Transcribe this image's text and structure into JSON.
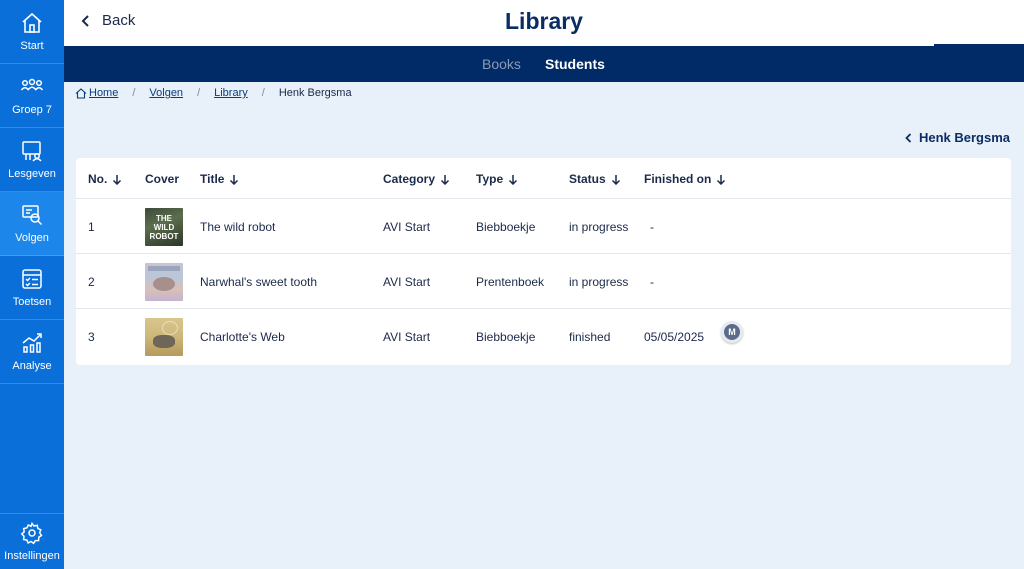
{
  "sidebar": {
    "items": [
      {
        "label": "Start",
        "icon": "home-icon"
      },
      {
        "label": "Groep 7",
        "icon": "group-icon"
      },
      {
        "label": "Lesgeven",
        "icon": "teach-icon"
      },
      {
        "label": "Volgen",
        "icon": "monitor-search-icon",
        "active": true
      },
      {
        "label": "Toetsen",
        "icon": "checklist-icon"
      },
      {
        "label": "Analyse",
        "icon": "analytics-icon"
      }
    ],
    "settings_label": "Instellingen"
  },
  "header": {
    "back_label": "Back",
    "title": "Library"
  },
  "tabs": [
    {
      "label": "Books",
      "active": false
    },
    {
      "label": "Students",
      "active": true
    }
  ],
  "breadcrumb": {
    "items": [
      "Home",
      "Volgen",
      "Library"
    ],
    "current": "Henk Bergsma"
  },
  "student_nav": {
    "name": "Henk Bergsma"
  },
  "table": {
    "columns": [
      "No.",
      "Cover",
      "Title",
      "Category",
      "Type",
      "Status",
      "Finished on"
    ],
    "rows": [
      {
        "no": "1",
        "title": "The wild robot",
        "cover_text": [
          "THE",
          "WILD",
          "ROBOT"
        ],
        "category": "AVI Start",
        "type": "Biebboekje",
        "status": "in progress",
        "finished_on": "-"
      },
      {
        "no": "2",
        "title": "Narwhal's sweet tooth",
        "category": "AVI Start",
        "type": "Prentenboek",
        "status": "in progress",
        "finished_on": "-"
      },
      {
        "no": "3",
        "title": "Charlotte's Web",
        "category": "AVI Start",
        "type": "Biebboekje",
        "status": "finished",
        "finished_on": "05/05/2025",
        "badge": "M"
      }
    ]
  },
  "colors": {
    "sidebar": "#0a6fd8",
    "sidebar_active": "#1d86ea",
    "tabbar": "#002b66",
    "title": "#0a2d63",
    "background": "#e8f0fa"
  }
}
